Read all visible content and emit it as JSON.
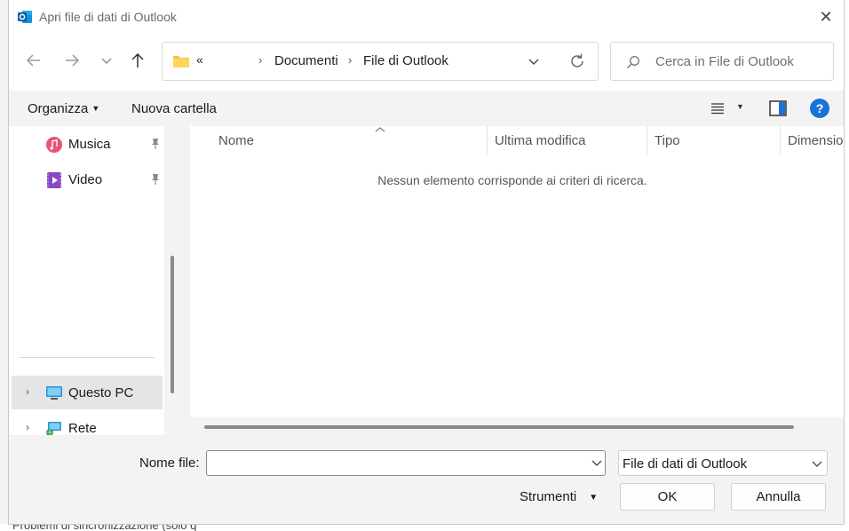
{
  "window": {
    "title": "Apri file di dati di Outlook",
    "close_label": "✕"
  },
  "navigation": {
    "back_icon": "arrow-left-icon",
    "forward_icon": "arrow-right-icon",
    "recent_icon": "chevron-down-icon",
    "up_icon": "arrow-up-icon"
  },
  "address": {
    "more": "«",
    "crumbs": [
      "Documenti",
      "File di Outlook"
    ],
    "separator": "›"
  },
  "search": {
    "placeholder": "Cerca in File di Outlook"
  },
  "toolbar": {
    "organize_label": "Organizza",
    "new_folder_label": "Nuova cartella",
    "help_label": "?"
  },
  "sidebar": {
    "items": [
      {
        "label": "Musica",
        "icon": "music-icon",
        "pinned": true
      },
      {
        "label": "Video",
        "icon": "video-icon",
        "pinned": true
      },
      {
        "label": "Questo PC",
        "icon": "computer-icon",
        "expandable": true,
        "selected": true
      },
      {
        "label": "Rete",
        "icon": "network-icon",
        "expandable": true
      }
    ]
  },
  "filelist": {
    "columns": [
      "Nome",
      "Ultima modifica",
      "Tipo",
      "Dimensione"
    ],
    "sorted_column": "Nome",
    "empty_message": "Nessun elemento corrisponde ai criteri di ricerca."
  },
  "footer": {
    "filename_label": "Nome file:",
    "filename_value": "",
    "filetype_value": "File di dati di Outlook",
    "tools_label": "Strumenti",
    "ok_label": "OK",
    "cancel_label": "Annulla"
  },
  "background": {
    "status_text": "Problemi di sincronizzazione (solo q"
  },
  "colors": {
    "accent": "#1a73d9",
    "folder": "#f5c342",
    "selection": "#e5e5e5"
  }
}
